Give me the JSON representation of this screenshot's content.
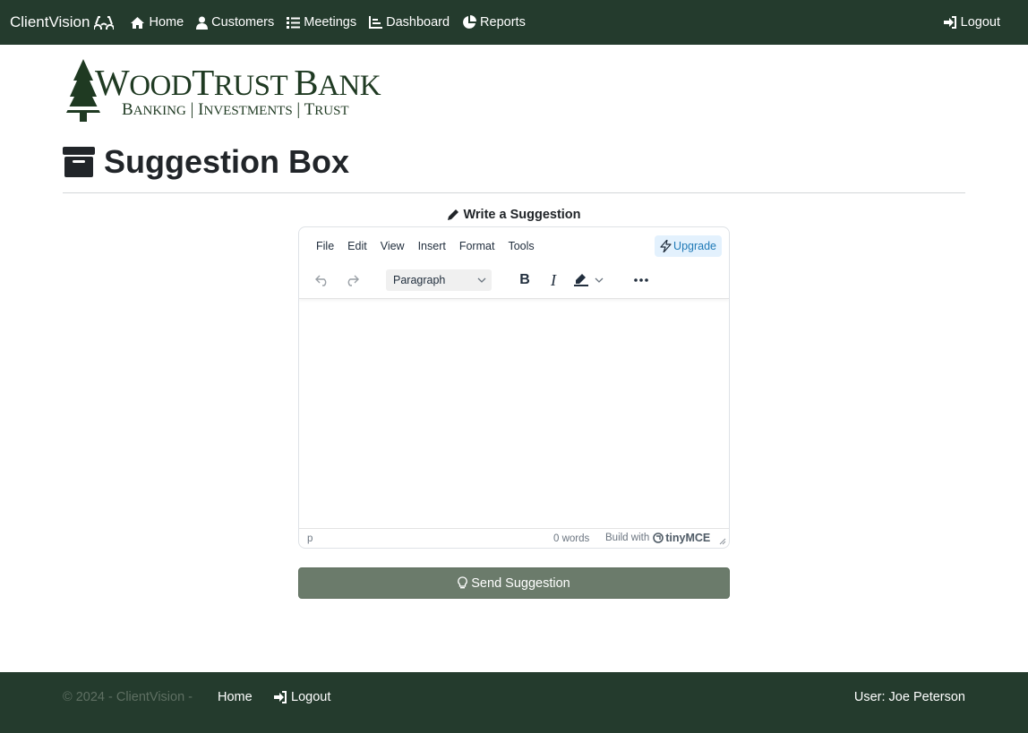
{
  "navbar": {
    "brand": "ClientVision",
    "links": [
      {
        "label": "Home",
        "icon": "home-icon"
      },
      {
        "label": "Customers",
        "icon": "person-icon"
      },
      {
        "label": "Meetings",
        "icon": "list-icon"
      },
      {
        "label": "Dashboard",
        "icon": "chart-icon"
      },
      {
        "label": "Reports",
        "icon": "pie-chart-icon"
      }
    ],
    "logout": "Logout"
  },
  "logo": {
    "title_parts": [
      "W",
      "OOD",
      "T",
      "RUST ",
      "B",
      "ANK"
    ],
    "subtitle_parts": [
      "B",
      "ANKING",
      " | ",
      "I",
      "NVESTMENTS",
      " | ",
      "T",
      "RUST"
    ]
  },
  "page": {
    "title": "Suggestion Box",
    "title_icon": "archive-icon"
  },
  "editor": {
    "section_label": "Write a Suggestion",
    "menu": [
      "File",
      "Edit",
      "View",
      "Insert",
      "Format",
      "Tools"
    ],
    "upgrade_label": "Upgrade",
    "block_format": "Paragraph",
    "content": "",
    "status": {
      "path": "p",
      "word_count": "0 words",
      "build_with": "Build with",
      "brand_name": "tinyMCE"
    }
  },
  "send_button": "Send Suggestion",
  "footer": {
    "copyright": "© 2024 - ClientVision -",
    "home": "Home",
    "logout": "Logout",
    "user": "User: Joe Peterson"
  },
  "colors": {
    "nav_bg": "#243b2d",
    "button_bg": "#6b7b6b",
    "logo_green": "#1f3a22",
    "upgrade_bg": "#e3f1fd"
  }
}
